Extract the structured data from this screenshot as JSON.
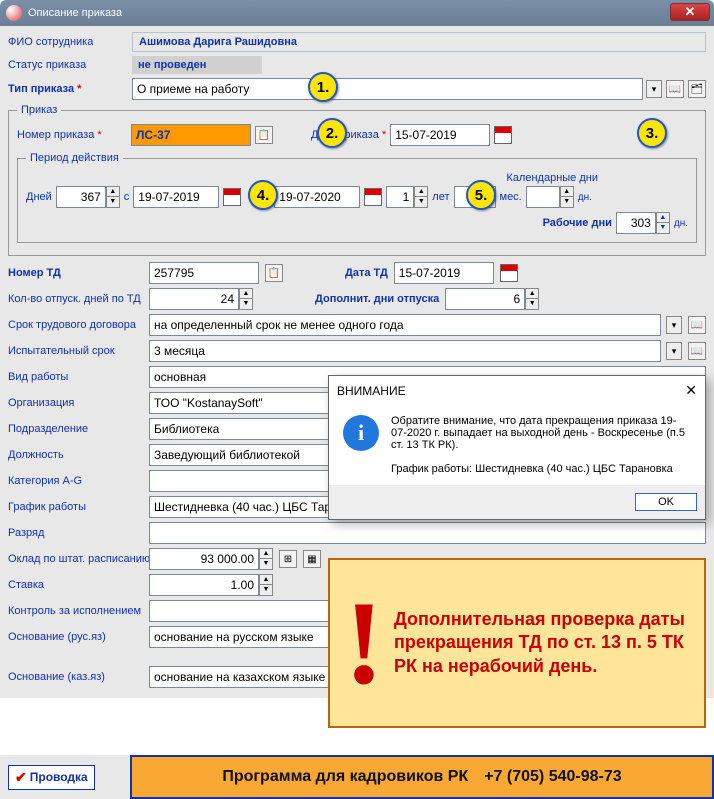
{
  "window": {
    "title": "Описание приказа"
  },
  "employee": {
    "label": "ФИО сотрудника",
    "name": "Ашимова Дарига Рашидовна"
  },
  "status": {
    "label": "Статус приказа",
    "value": "не проведен"
  },
  "orderType": {
    "label": "Тип приказа",
    "value": "О приеме на работу"
  },
  "order": {
    "groupTitle": "Приказ",
    "numberLabel": "Номер приказа",
    "number": "ЛС-37",
    "dateLabel": "Дата приказа",
    "date": "15-07-2019"
  },
  "period": {
    "groupTitle": "Период действия",
    "daysLabel": "Дней",
    "days": "367",
    "fromLabel": "с",
    "from": "19-07-2019",
    "toLabel": "по",
    "to": "19-07-2020",
    "years": "1",
    "yearsLabel": "лет",
    "months": "",
    "monthsLabel": "мес.",
    "calLabel": "Календарные дни",
    "calDays": "",
    "calDaysSuffix": "дн.",
    "workLabel": "Рабочие дни",
    "workDays": "303",
    "workDaysSuffix": "дн."
  },
  "td": {
    "numberLabel": "Номер ТД",
    "number": "257795",
    "dateLabel": "Дата ТД",
    "date": "15-07-2019"
  },
  "vacation": {
    "daysLabel": "Кол-во отпуск. дней по ТД",
    "days": "24",
    "addLabel": "Дополнит. дни отпуска",
    "addDays": "6"
  },
  "fields": {
    "contractTermLabel": "Срок трудового договора",
    "contractTerm": "на определенный срок не менее одного года",
    "probationLabel": "Испытательный срок",
    "probation": "3 месяца",
    "workTypeLabel": "Вид работы",
    "workType": "основная",
    "orgLabel": "Организация",
    "org": "ТОО \"KostanaySoft\"",
    "deptLabel": "Подразделение",
    "dept": "Библиотека",
    "positionLabel": "Должность",
    "position": "Заведующий библиотекой",
    "categoryLabel": "Категория A-G",
    "category": "",
    "scheduleLabel": "График работы",
    "schedule": "Шестидневка (40 час.) ЦБС Тарановка",
    "rankLabel": "Разряд",
    "rank": "",
    "salaryLabel": "Оклад по штат. расписанию",
    "salary": "93 000.00",
    "rateLabel": "Ставка",
    "rate": "1.00",
    "controlLabel": "Контроль за исполнением",
    "control": "",
    "basisRuLabel": "Основание (рус.яз)",
    "basisRu": "основание на русском языке",
    "basisKzLabel": "Основание (каз.яз)",
    "basisKz": "основание на казахском языке"
  },
  "markers": {
    "m1": "1.",
    "m2": "2.",
    "m3": "3.",
    "m4": "4.",
    "m5": "5."
  },
  "popup": {
    "title": "ВНИМАНИЕ",
    "line1": "Обратите внимание, что дата прекращения приказа 19-07-2020 г. выпадает на выходной день - Воскресенье (п.5 ст. 13 ТК РК).",
    "line2": "График работы: Шестидневка (40 час.) ЦБС Тарановка",
    "ok": "OK"
  },
  "banner": {
    "text": "Дополнительная проверка даты прекращения ТД по ст. 13 п. 5 ТК РК на нерабочий день."
  },
  "footer": {
    "provodka": "Проводка",
    "programText": "Программа для кадровиков РК",
    "phone": "+7 (705) 540-98-73"
  }
}
